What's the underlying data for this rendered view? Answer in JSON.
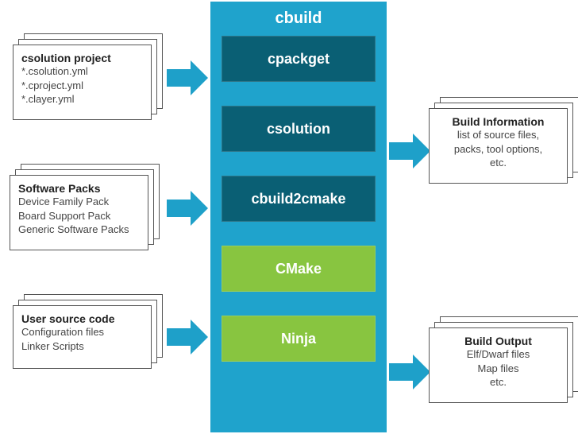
{
  "pillar": {
    "title": "cbuild",
    "modules": [
      {
        "label": "cpackget",
        "colorClass": "teal"
      },
      {
        "label": "csolution",
        "colorClass": "teal"
      },
      {
        "label": "cbuild2cmake",
        "colorClass": "teal"
      },
      {
        "label": "CMake",
        "colorClass": "green"
      },
      {
        "label": "Ninja",
        "colorClass": "green"
      }
    ]
  },
  "left_boxes": [
    {
      "title": "csolution project",
      "lines": [
        "*.csolution.yml",
        "*.cproject.yml",
        "*.clayer.yml"
      ]
    },
    {
      "title": "Software Packs",
      "lines": [
        "Device Family Pack",
        "Board Support Pack",
        "Generic Software Packs"
      ]
    },
    {
      "title": "User source code",
      "lines": [
        "Configuration files",
        "Linker Scripts"
      ]
    }
  ],
  "right_boxes": [
    {
      "title": "Build Information",
      "lines": [
        "list of source files,",
        "packs, tool options,",
        "etc."
      ]
    },
    {
      "title": "Build Output",
      "lines": [
        "Elf/Dwarf files",
        "Map files",
        "etc."
      ]
    }
  ]
}
